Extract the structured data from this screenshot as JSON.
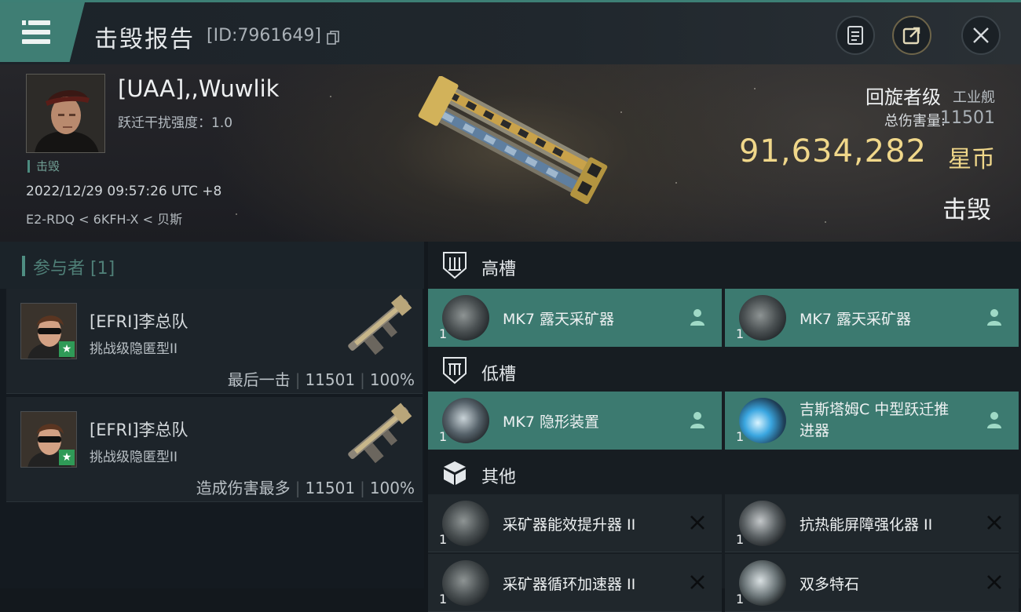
{
  "header": {
    "title": "击毁报告",
    "report_id": "[ID:7961649]"
  },
  "victim": {
    "name": "[UAA],,Wuwlik",
    "jam_strength": "跃迁干扰强度：1.0",
    "status_tag": "击毁",
    "time": "2022/12/29 09:57:26 UTC +8",
    "location": "E2-RDQ < 6KFH-X < 贝斯",
    "ship_name": "回旋者级",
    "ship_class": "工业舰",
    "total_damage_label": "总伤害量:",
    "total_damage_value": "11501",
    "isk_value": "91,634,282",
    "isk_unit": "星币",
    "result": "击毁"
  },
  "participants": {
    "label": "参与者 [1]",
    "items": [
      {
        "name": "[EFRI]李总队",
        "ship": "挑战级隐匿型II",
        "role": "最后一击",
        "damage": "11501",
        "percent": "100%"
      },
      {
        "name": "[EFRI]李总队",
        "ship": "挑战级隐匿型II",
        "role": "造成伤害最多",
        "damage": "11501",
        "percent": "100%"
      }
    ]
  },
  "fitting": {
    "high": {
      "label": "高槽",
      "modules": [
        {
          "name": "MK7 露天采矿器",
          "qty": "1",
          "status": "dropped"
        },
        {
          "name": "MK7 露天采矿器",
          "qty": "1",
          "status": "dropped"
        }
      ]
    },
    "low": {
      "label": "低槽",
      "modules": [
        {
          "name": "MK7 隐形装置",
          "qty": "1",
          "status": "dropped"
        },
        {
          "name_line1": "吉斯塔姆C 中型跃迁推",
          "name_line2": "进器",
          "qty": "1",
          "status": "dropped"
        }
      ]
    },
    "other": {
      "label": "其他",
      "modules": [
        {
          "name": "采矿器能效提升器 II",
          "qty": "1",
          "status": "destroyed"
        },
        {
          "name": "抗热能屏障强化器 II",
          "qty": "1",
          "status": "destroyed"
        },
        {
          "name": "采矿器循环加速器 II",
          "qty": "1",
          "status": "destroyed"
        },
        {
          "name": "双多特石",
          "qty": "1",
          "status": "destroyed"
        }
      ]
    }
  },
  "colors": {
    "accent_teal": "#3c7a70",
    "isk_gold": "#f0d78a"
  }
}
